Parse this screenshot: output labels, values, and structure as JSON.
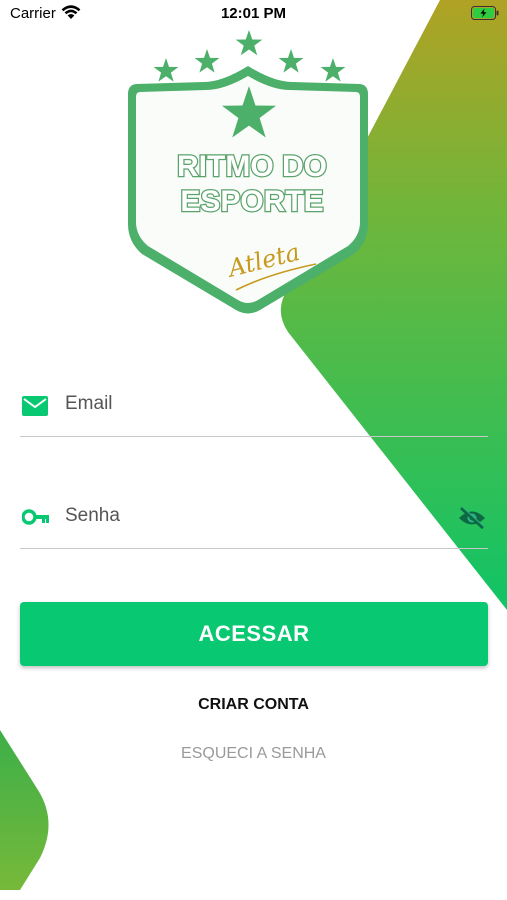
{
  "status_bar": {
    "carrier": "Carrier",
    "time": "12:01 PM",
    "wifi_icon": "wifi-icon",
    "battery_icon": "battery-charging-icon"
  },
  "logo": {
    "line1": "RITMO DO",
    "line2": "ESPORTE",
    "signature": "Atleta"
  },
  "form": {
    "email_placeholder": "Email",
    "email_icon": "mail-icon",
    "password_placeholder": "Senha",
    "password_icon": "key-icon",
    "visibility_icon": "eye-off-icon"
  },
  "actions": {
    "login_label": "ACESSAR",
    "create_account_label": "CRIAR CONTA",
    "forgot_password_label": "ESQUECI A SENHA"
  },
  "colors": {
    "primary": "#08c872",
    "gradient_top": "#a9a422",
    "gradient_bottom": "#10c466",
    "shield_green": "#4caf6a",
    "signature_gold": "#c79a1d"
  }
}
